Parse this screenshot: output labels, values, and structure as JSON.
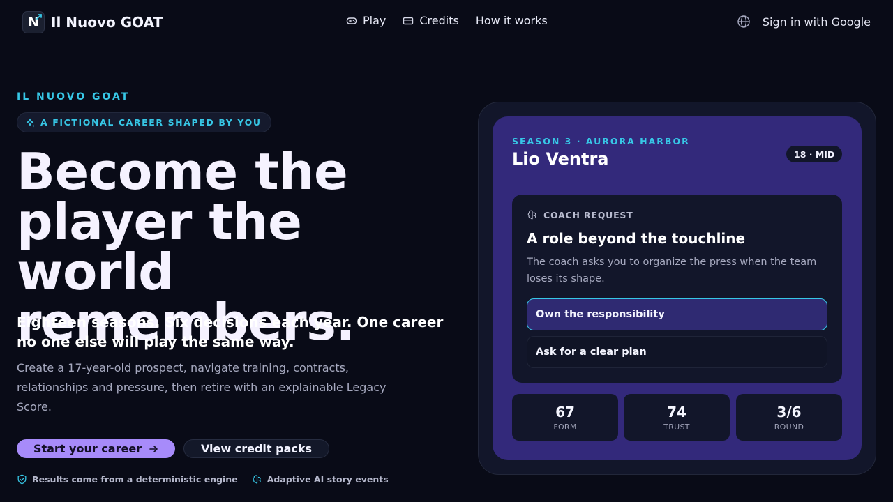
{
  "header": {
    "brand_letter": "N",
    "brand_name": "Il Nuovo GOAT",
    "nav": [
      {
        "label": "Play",
        "icon": "gamepad-icon"
      },
      {
        "label": "Credits",
        "icon": "credit-card-icon"
      },
      {
        "label": "How it works"
      }
    ],
    "language_icon": "globe-icon",
    "signin_label": "Sign in with Google"
  },
  "hero": {
    "eyebrow": "IL NUOVO GOAT",
    "pill_label": "A FICTIONAL CAREER SHAPED BY YOU",
    "headline_lines": [
      "Become the",
      "player the world",
      "remembers."
    ],
    "subhead": "Eighteen seasons. Six decisions each year. One career no one else will play the same way.",
    "description": "Create a 17-year-old prospect, navigate training, contracts, relationships and pressure, then retire with an explainable Legacy Score.",
    "cta_primary": "Start your career",
    "cta_secondary": "View credit packs",
    "features": [
      {
        "label": "Results come from a deterministic engine",
        "icon": "shield-check-icon"
      },
      {
        "label": "Adaptive AI story events",
        "icon": "brain-icon"
      }
    ]
  },
  "card": {
    "season": "SEASON 3 · AURORA HARBOR",
    "player_name": "Lio Ventra",
    "age_badge": "18 · MID",
    "event": {
      "tag": "COACH REQUEST",
      "title": "A role beyond the touchline",
      "text": "The coach asks you to organize the press when the team loses its shape.",
      "choices": [
        "Own the responsibility",
        "Ask for a clear plan"
      ]
    },
    "stats": [
      {
        "value": "67",
        "label": "FORM"
      },
      {
        "value": "74",
        "label": "TRUST"
      },
      {
        "value": "3/6",
        "label": "ROUND"
      }
    ]
  },
  "colors": {
    "background": "#090b17",
    "accent_cyan": "#37c7e6",
    "accent_violet": "#a78bfa",
    "card_purple": "#33297b"
  }
}
